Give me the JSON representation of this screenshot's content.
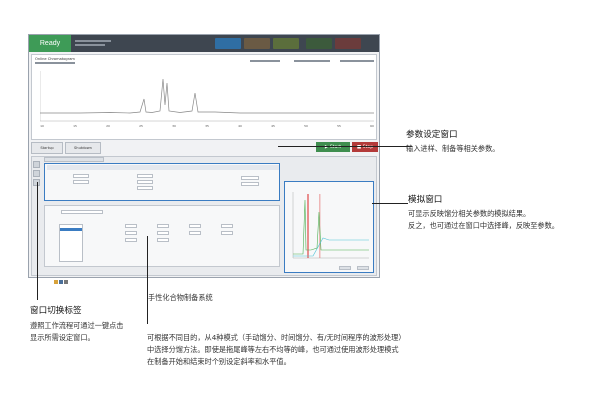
{
  "window": {
    "status": "Ready",
    "toolbar_buttons": [
      {
        "label": "",
        "color": "#2f6ea3"
      },
      {
        "label": "",
        "color": "#6a5a44"
      },
      {
        "label": "",
        "color": "#5b6e3c"
      },
      {
        "label": "",
        "color": "#3c5a3c"
      },
      {
        "label": "",
        "color": "#6b3c3c"
      }
    ],
    "chromatogram": {
      "title": "Online Chromatogram",
      "x_ticks": [
        "10",
        "15",
        "20",
        "25",
        "30",
        "35",
        "40",
        "45",
        "50",
        "55",
        "60"
      ],
      "peaks_label": ""
    },
    "buttons": {
      "setup": "Startup",
      "shutdown": "Shutdown",
      "start": "Start",
      "stop": "Stop"
    },
    "simulation": {
      "title": "",
      "colors": {
        "line1": "#4caf50",
        "line2": "#4fc3d6",
        "peak": "#e57373"
      }
    }
  },
  "callouts": {
    "params": {
      "title": "参数设定窗口",
      "desc": [
        "输入进样、制备等相关参数。"
      ]
    },
    "sim": {
      "title": "模拟窗口",
      "desc": [
        "可显示反映馏分相关参数的模拟结果。",
        "反之，也可通过在窗口中选择峰，反映至参数。"
      ]
    },
    "tabs": {
      "title": "窗口切换标签",
      "desc": [
        "遵照工作流程可通过一键点击",
        "显示所需设定窗口。"
      ]
    },
    "caption": "手性化合物制备系统",
    "fraction": {
      "desc": [
        "可根据不同目的，从4种模式（手动馏分、时间馏分、有/无时间程序的波形处理）",
        "中选择分馏方法。即使是拖尾峰等左右不均等的峰，也可通过使用波形处理模式",
        "在制备开始和结束时个别设定斜率和水平值。"
      ]
    }
  }
}
